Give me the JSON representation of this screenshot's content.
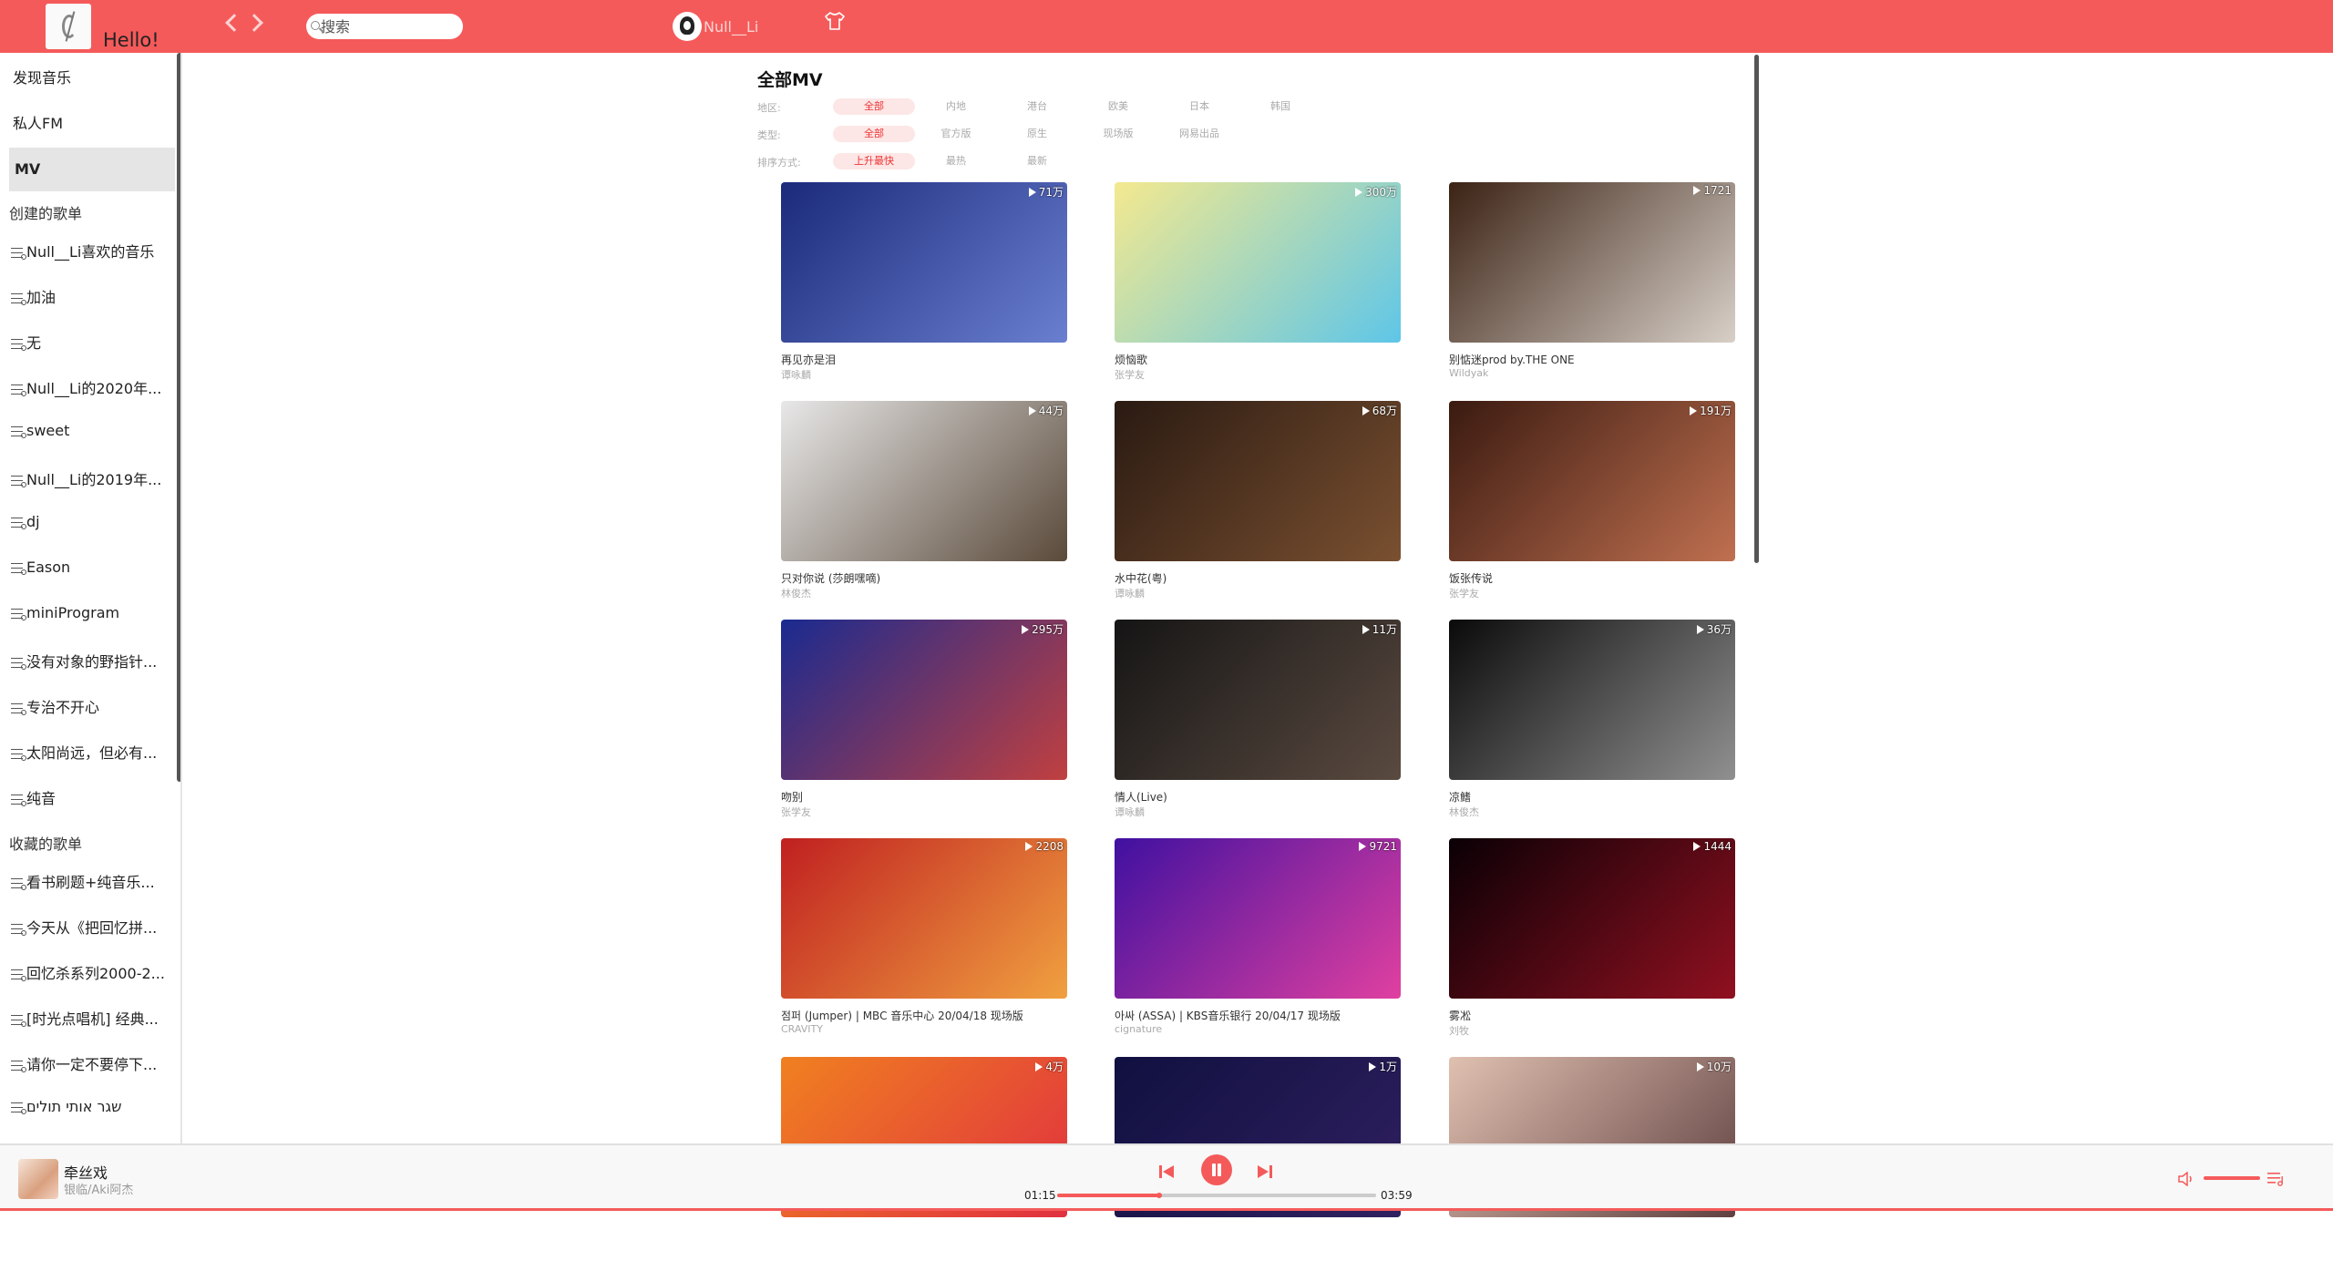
{
  "header": {
    "greeting": "Hello!",
    "search_placeholder": "搜索",
    "username": "Null__Li"
  },
  "sidebar": {
    "nav": [
      {
        "label": "发现音乐",
        "active": false
      },
      {
        "label": "私人FM",
        "active": false
      },
      {
        "label": "MV",
        "active": true
      }
    ],
    "created_heading": "创建的歌单",
    "created": [
      "Null__Li喜欢的音乐",
      "加油",
      "无",
      "Null__Li的2020年...",
      "sweet",
      "Null__Li的2019年...",
      "dj",
      "Eason",
      "miniProgram",
      "没有对象的野指针...",
      "专治不开心",
      "太阳尚远，但必有...",
      "纯音"
    ],
    "collected_heading": "收藏的歌单",
    "collected": [
      "看书刷题+纯音乐...",
      "今天从《把回忆拼...",
      "回忆杀系列2000-2...",
      "[时光点唱机] 经典...",
      "请你一定不要停下...",
      "שגר אותי תולים"
    ]
  },
  "main": {
    "title": "全部MV",
    "filters": [
      {
        "label": "地区:",
        "options": [
          "全部",
          "内地",
          "港台",
          "欧美",
          "日本",
          "韩国"
        ],
        "selected": 0
      },
      {
        "label": "类型:",
        "options": [
          "全部",
          "官方版",
          "原生",
          "现场版",
          "网易出品"
        ],
        "selected": 0
      },
      {
        "label": "排序方式:",
        "options": [
          "上升最快",
          "最热",
          "最新"
        ],
        "selected": 0
      }
    ],
    "mvs": [
      {
        "title": "再见亦是泪",
        "artist": "谭咏麟",
        "plays": "71万",
        "colors": [
          "#1b2a7a",
          "#6a7fd0"
        ]
      },
      {
        "title": "烦恼歌",
        "artist": "张学友",
        "plays": "300万",
        "colors": [
          "#f4e98f",
          "#5ec6e8"
        ]
      },
      {
        "title": "别惦迷prod by.THE ONE",
        "artist": "Wildyak",
        "plays": "1721",
        "colors": [
          "#3b2214",
          "#d8d0c8"
        ]
      },
      {
        "title": "只对你说 (莎朗嘿嘀)",
        "artist": "林俊杰",
        "plays": "44万",
        "colors": [
          "#e8e8e8",
          "#5a4a3a"
        ]
      },
      {
        "title": "水中花(粤)",
        "artist": "谭咏麟",
        "plays": "68万",
        "colors": [
          "#2a1a12",
          "#7a5030"
        ]
      },
      {
        "title": "饭张传说",
        "artist": "张学友",
        "plays": "191万",
        "colors": [
          "#3a1a10",
          "#c07050"
        ]
      },
      {
        "title": "吻别",
        "artist": "张学友",
        "plays": "295万",
        "colors": [
          "#1a2a90",
          "#c04040"
        ]
      },
      {
        "title": "情人(Live)",
        "artist": "谭咏麟",
        "plays": "11万",
        "colors": [
          "#151515",
          "#5a4a40"
        ]
      },
      {
        "title": "凉鳍",
        "artist": "林俊杰",
        "plays": "36万",
        "colors": [
          "#0a0a0a",
          "#909090"
        ]
      },
      {
        "title": "점퍼 (Jumper) | MBC 音乐中心 20/04/18 现场版",
        "artist": "CRAVITY",
        "plays": "2208",
        "colors": [
          "#c02020",
          "#f0a040"
        ]
      },
      {
        "title": "아싸 (ASSA) | KBS音乐银行 20/04/17 现场版",
        "artist": "cignature",
        "plays": "9721",
        "colors": [
          "#4010a0",
          "#e040a0"
        ]
      },
      {
        "title": "雾凇",
        "artist": "刘牧",
        "plays": "1444",
        "colors": [
          "#0a0005",
          "#901020"
        ]
      },
      {
        "title": "",
        "artist": "",
        "plays": "4万",
        "colors": [
          "#f08020",
          "#e03040"
        ]
      },
      {
        "title": "",
        "artist": "",
        "plays": "1万",
        "colors": [
          "#101040",
          "#302060"
        ]
      },
      {
        "title": "",
        "artist": "",
        "plays": "10万",
        "colors": [
          "#e0c0b0",
          "#604040"
        ]
      }
    ]
  },
  "player": {
    "song": "牵丝戏",
    "artist": "银临/Aki阿杰",
    "current_time": "01:15",
    "total_time": "03:59",
    "progress": 0.32,
    "volume": 1.0
  }
}
